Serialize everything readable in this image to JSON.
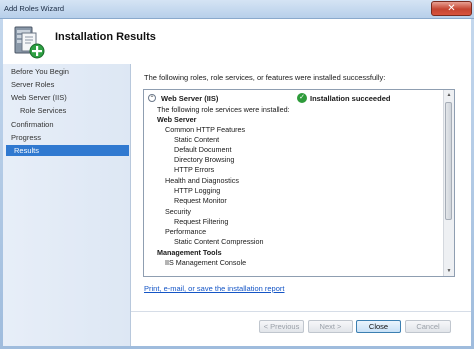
{
  "window": {
    "title": "Add Roles Wizard"
  },
  "header": {
    "title": "Installation Results"
  },
  "nav": {
    "items": [
      {
        "label": "Before You Begin"
      },
      {
        "label": "Server Roles"
      },
      {
        "label": "Web Server (IIS)"
      },
      {
        "label": "Role Services"
      },
      {
        "label": "Confirmation"
      },
      {
        "label": "Progress"
      },
      {
        "label": "Results"
      }
    ]
  },
  "content": {
    "intro": "The following roles, role services, or features were installed successfully:",
    "role": {
      "name": "Web Server (IIS)",
      "status": "Installation succeeded",
      "lines": [
        "The following role services were installed:",
        "Web Server",
        "Common HTTP Features",
        "Static Content",
        "Default Document",
        "Directory Browsing",
        "HTTP Errors",
        "Health and Diagnostics",
        "HTTP Logging",
        "Request Monitor",
        "Security",
        "Request Filtering",
        "Performance",
        "Static Content Compression",
        "Management Tools",
        "IIS Management Console"
      ]
    },
    "report_link": "Print, e-mail, or save the installation report"
  },
  "buttons": {
    "previous": "< Previous",
    "next": "Next >",
    "close": "Close",
    "cancel": "Cancel"
  },
  "colors": {
    "nav_active": "#3079d0",
    "link": "#1455c6",
    "success": "#2e9b3a"
  }
}
